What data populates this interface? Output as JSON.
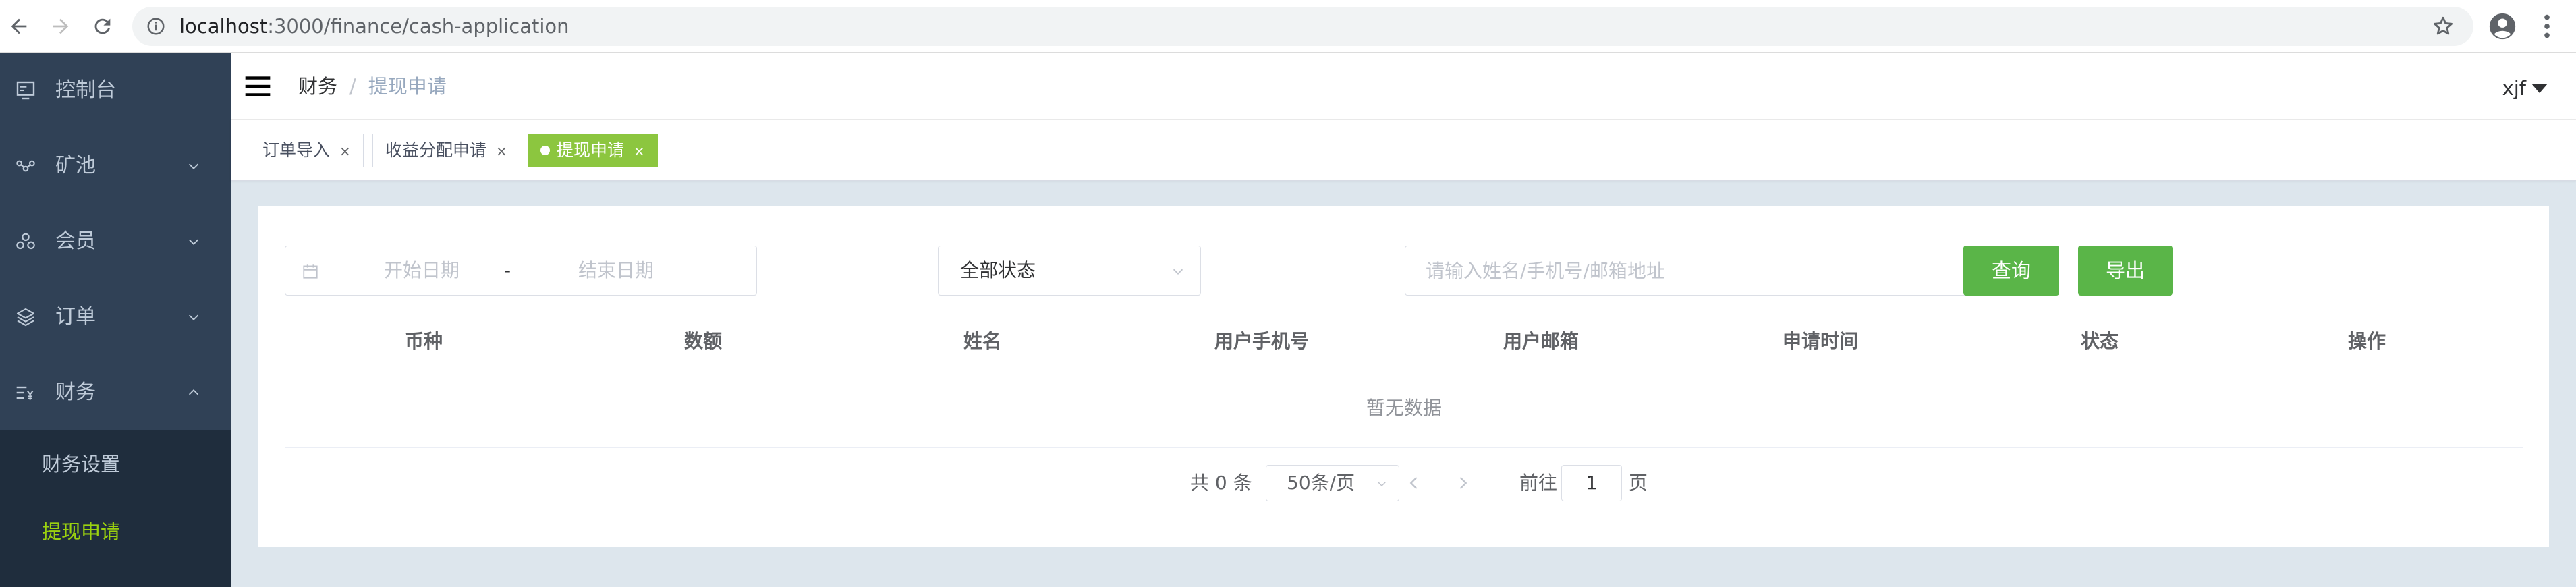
{
  "browser": {
    "url_host": "localhost",
    "url_path": ":3000/finance/cash-application"
  },
  "sidebar": {
    "items": [
      {
        "label": "控制台",
        "icon": "dashboard-icon"
      },
      {
        "label": "矿池",
        "icon": "network-icon"
      },
      {
        "label": "会员",
        "icon": "members-icon"
      },
      {
        "label": "订单",
        "icon": "layers-icon"
      },
      {
        "label": "财务",
        "icon": "finance-icon"
      }
    ],
    "submenu": [
      {
        "label": "财务设置"
      },
      {
        "label": "提现申请"
      }
    ]
  },
  "header": {
    "breadcrumb": [
      "财务",
      "提现申请"
    ],
    "user": "xjf"
  },
  "tags": [
    {
      "label": "订单导入"
    },
    {
      "label": "收益分配申请"
    },
    {
      "label": "提现申请"
    }
  ],
  "filters": {
    "start_placeholder": "开始日期",
    "range_separator": "-",
    "end_placeholder": "结束日期",
    "status_value": "全部状态",
    "search_placeholder": "请输入姓名/手机号/邮箱地址",
    "query_label": "查询",
    "export_label": "导出"
  },
  "table": {
    "columns": [
      "币种",
      "数额",
      "姓名",
      "用户手机号",
      "用户邮箱",
      "申请时间",
      "状态",
      "操作"
    ],
    "empty_text": "暂无数据"
  },
  "pagination": {
    "total_text": "共 0 条",
    "page_size": "50条/页",
    "goto_label": "前往",
    "current_page": "1",
    "page_suffix": "页"
  },
  "colors": {
    "sidebar_bg": "#304156",
    "submenu_bg": "#1f2d3d",
    "accent_green": "#5ab548",
    "active_tag": "#8cc63f"
  }
}
